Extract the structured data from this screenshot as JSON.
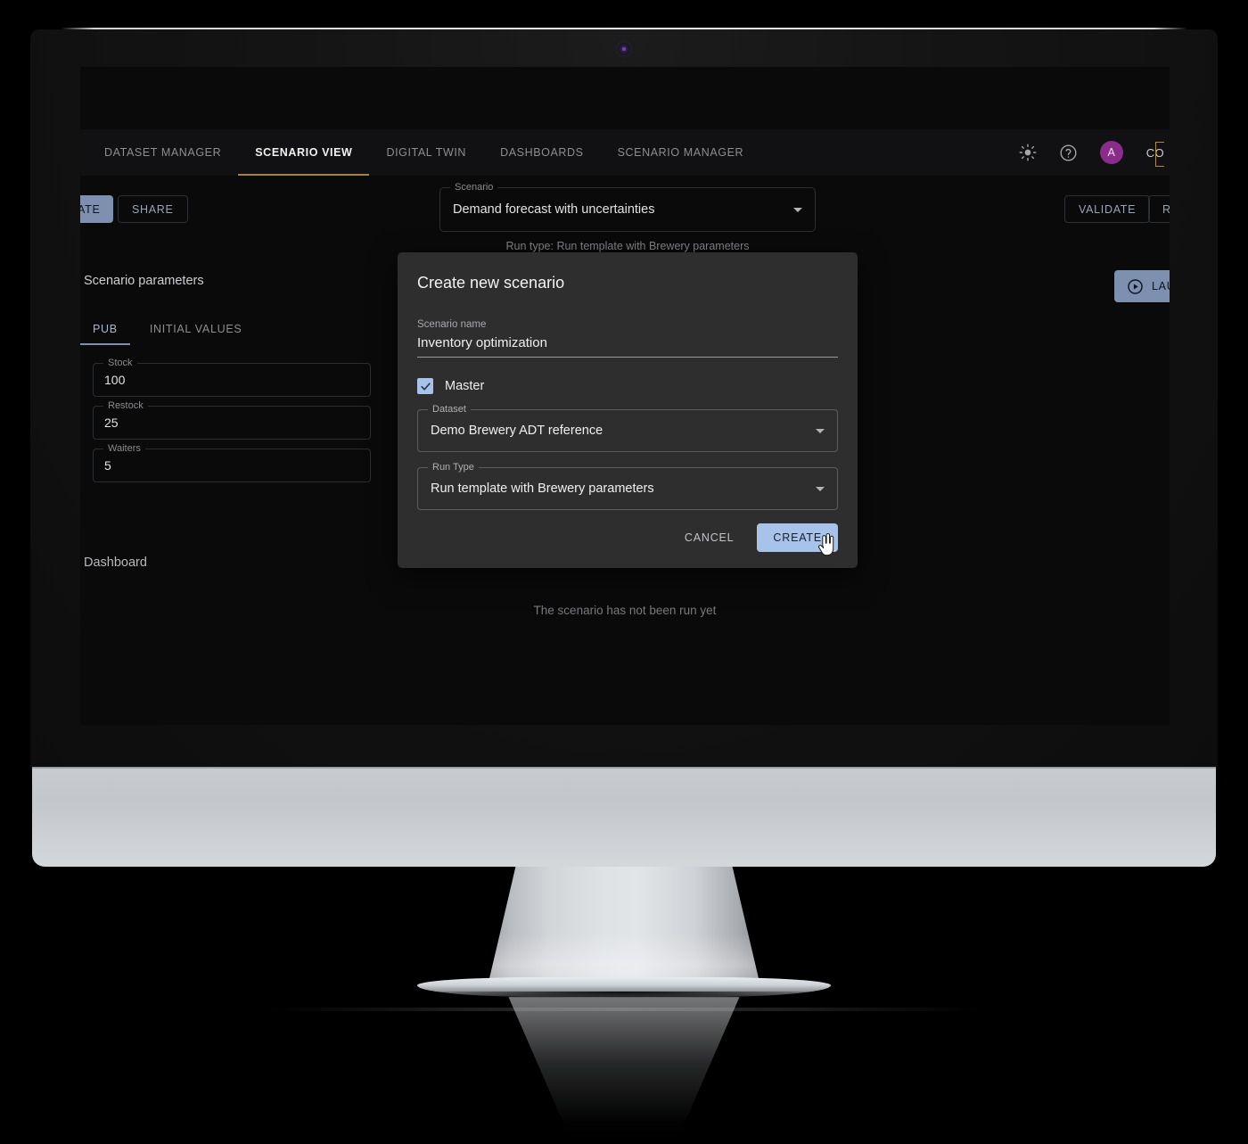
{
  "nav": {
    "tabs": [
      {
        "label": "DATASET MANAGER",
        "active": false
      },
      {
        "label": "SCENARIO VIEW",
        "active": true
      },
      {
        "label": "DIGITAL TWIN",
        "active": false
      },
      {
        "label": "DASHBOARDS",
        "active": false
      },
      {
        "label": "SCENARIO MANAGER",
        "active": false
      }
    ],
    "theme_icon": "sun-icon",
    "help_icon": "help-circle-icon",
    "avatar_initial": "A",
    "brand_text": "CO",
    "accent_underline": "#a78431",
    "brand_bracket_color": "#a88a45"
  },
  "toolbar": {
    "create_label": "ATE",
    "share_label": "SHARE",
    "validate_label": "VALIDATE",
    "reset_label": "RE",
    "scenario_field_label": "Scenario",
    "scenario_value": "Demand forecast with uncertainties",
    "run_type_note": "Run type: Run template with Brewery parameters"
  },
  "parameters": {
    "title": "Scenario parameters",
    "tabs": [
      {
        "label": "PUB",
        "active": true
      },
      {
        "label": "INITIAL VALUES",
        "active": false
      }
    ],
    "fields": [
      {
        "label": "Stock",
        "value": "100"
      },
      {
        "label": "Restock",
        "value": "25"
      },
      {
        "label": "Waiters",
        "value": "5"
      }
    ]
  },
  "launch": {
    "label": "LAUN",
    "icon": "play-circle-icon"
  },
  "dashboard": {
    "title": "Dashboard",
    "empty_message": "The scenario has not been run yet"
  },
  "modal": {
    "title": "Create new scenario",
    "name_label": "Scenario name",
    "name_value": "Inventory optimization",
    "name_placeholder": "Scenario name",
    "master_label": "Master",
    "master_checked": true,
    "dataset_label": "Dataset",
    "dataset_value": "Demo Brewery ADT reference",
    "run_type_label": "Run Type",
    "run_type_value": "Run template with Brewery parameters",
    "cancel_label": "CANCEL",
    "create_label": "CREATE",
    "accent_color": "#a8c3ea"
  }
}
